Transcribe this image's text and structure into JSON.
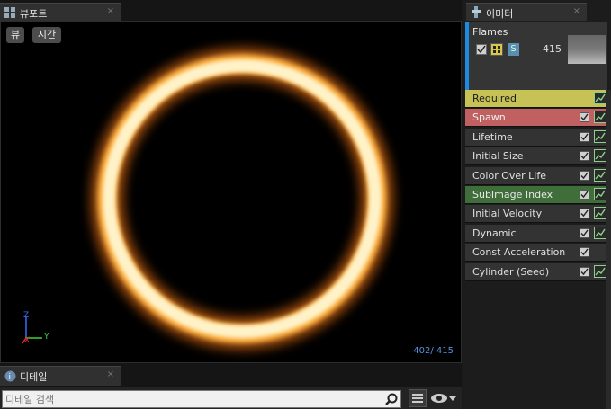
{
  "viewport_tab": {
    "title": "뷰포트",
    "close": "×"
  },
  "viewport": {
    "view_button": "뷰",
    "time_button": "시간",
    "particle_count": "402/ 415",
    "axes": {
      "z": "Z",
      "x": "X",
      "y": "Y"
    }
  },
  "details_tab": {
    "title": "디테일",
    "close": "×"
  },
  "details": {
    "search_placeholder": "디테일 검색"
  },
  "emitter_tab": {
    "title": "이미터",
    "close": "×"
  },
  "emitter": {
    "name": "Flames",
    "solo_label": "S",
    "count": "415",
    "accent_color": "#1e8be0"
  },
  "modules": [
    {
      "label": "Required",
      "color": "#c7c255",
      "text_color": "#1a1a1a",
      "has_checkbox": false,
      "has_graph": true
    },
    {
      "label": "Spawn",
      "color": "#c06060",
      "text_color": "#f0f0f0",
      "has_checkbox": true,
      "has_graph": true
    },
    {
      "label": "Lifetime",
      "color": "#333333",
      "text_color": "#e0e0e0",
      "has_checkbox": true,
      "has_graph": true
    },
    {
      "label": "Initial Size",
      "color": "#333333",
      "text_color": "#e0e0e0",
      "has_checkbox": true,
      "has_graph": true
    },
    {
      "label": "Color Over Life",
      "color": "#333333",
      "text_color": "#e0e0e0",
      "has_checkbox": true,
      "has_graph": true
    },
    {
      "label": "SubImage Index",
      "color": "#3f6e3a",
      "text_color": "#e8e8e8",
      "has_checkbox": true,
      "has_graph": true
    },
    {
      "label": "Initial Velocity",
      "color": "#333333",
      "text_color": "#e0e0e0",
      "has_checkbox": true,
      "has_graph": true
    },
    {
      "label": "Dynamic",
      "color": "#333333",
      "text_color": "#e0e0e0",
      "has_checkbox": true,
      "has_graph": true
    },
    {
      "label": "Const Acceleration",
      "color": "#333333",
      "text_color": "#e0e0e0",
      "has_checkbox": true,
      "has_graph": false
    },
    {
      "label": "Cylinder (Seed)",
      "color": "#333333",
      "text_color": "#e0e0e0",
      "has_checkbox": true,
      "has_graph": true
    }
  ]
}
